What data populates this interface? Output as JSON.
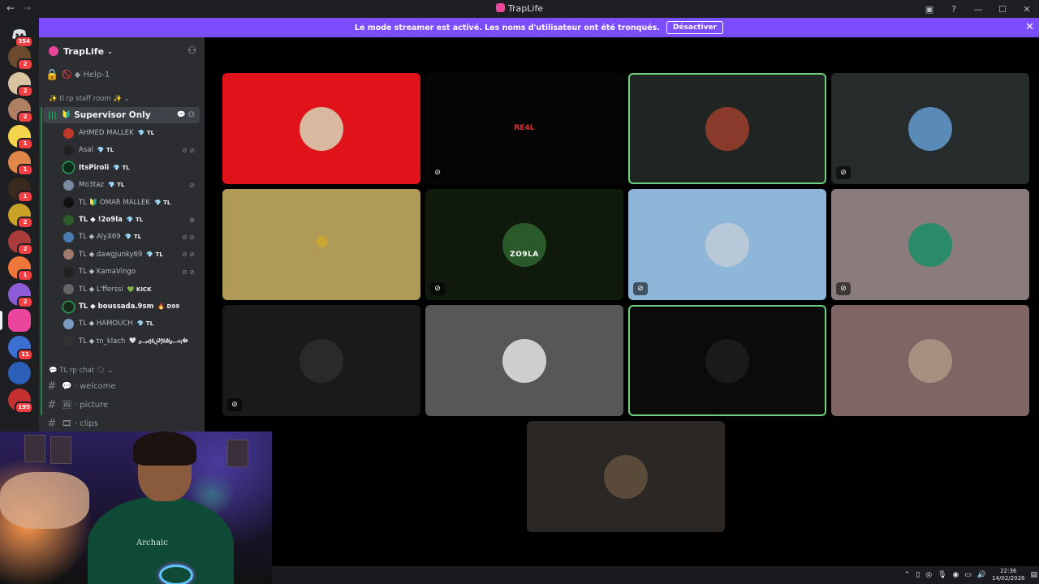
{
  "window": {
    "title": "TrapLife"
  },
  "banner": {
    "text": "Le mode streamer est activé. Les noms d'utilisateur ont été tronqués.",
    "button": "Désactiver"
  },
  "rail": {
    "home_badge": "354",
    "servers": [
      {
        "color": "#6b4a2e",
        "badge": "2"
      },
      {
        "color": "#d9c3a0",
        "badge": "2"
      },
      {
        "color": "#b07e62",
        "badge": "2"
      },
      {
        "color": "#f3d44a",
        "badge": "1"
      },
      {
        "color": "#e0884a",
        "badge": "1"
      },
      {
        "color": "#3a2a1e",
        "badge": "1"
      },
      {
        "color": "#c9a227",
        "badge": "2"
      },
      {
        "color": "#a93b3b",
        "badge": "2"
      },
      {
        "color": "#f0773a",
        "badge": "1"
      },
      {
        "color": "#8e5bd6",
        "badge": "2"
      },
      {
        "color": "#eb459e",
        "badge": ""
      },
      {
        "color": "#3b6fd1",
        "badge": "11"
      },
      {
        "color": "#2b5fb8",
        "badge": ""
      },
      {
        "color": "#c43030",
        "badge": "195"
      }
    ]
  },
  "sidebar": {
    "server_name": "TrapLife",
    "channels_top": [
      {
        "icon": "🔒",
        "label": "🚫 ◆ Help-1"
      }
    ],
    "category_staff": "✨ tl rp staff room ✨",
    "active_voice": "Supervisor Only",
    "voice_users": [
      {
        "name": "AHMED MALLEK",
        "tag": "💎 TL",
        "color": "#c0392b",
        "mute": "",
        "bold": false,
        "speaking": false
      },
      {
        "name": "Asal",
        "tag": "💎 TL",
        "color": "#222",
        "mute": "⊘ ⊘",
        "bold": false,
        "speaking": false
      },
      {
        "name": "ItsPiroli",
        "tag": "💎 TL",
        "color": "#0d2a1a",
        "mute": "",
        "bold": true,
        "speaking": true
      },
      {
        "name": "Mo3taz",
        "tag": "💎 TL",
        "color": "#7a8aa0",
        "mute": "⊘",
        "bold": false,
        "speaking": false
      },
      {
        "name": "TL 🔰 OMAR MALLEK",
        "tag": "💎 TL",
        "color": "#111",
        "mute": "",
        "bold": false,
        "speaking": false
      },
      {
        "name": "TL ◆ !2o9la",
        "tag": "💎 TL",
        "color": "#2f5a2a",
        "mute": "⊘",
        "bold": true,
        "speaking": false
      },
      {
        "name": "TL ◆ AlyX69",
        "tag": "💎 TL",
        "color": "#4a7ab0",
        "mute": "⊘ ⊘",
        "bold": false,
        "speaking": false
      },
      {
        "name": "TL ◆ dawgjunky69",
        "tag": "💎 TL",
        "color": "#a07a6a",
        "mute": "⊘ ⊘",
        "bold": false,
        "speaking": false
      },
      {
        "name": "TL ◆ KamaVingo",
        "tag": "",
        "color": "#222",
        "mute": "⊘ ⊘",
        "bold": false,
        "speaking": false
      },
      {
        "name": "TL ◆ L'fferssi",
        "tag": "💚 KICK",
        "color": "#666",
        "mute": "",
        "bold": false,
        "speaking": false
      },
      {
        "name": "TL ◆ boussada.9sm",
        "tag": "🔥 D99",
        "color": "#1a2a1a",
        "mute": "",
        "bold": true,
        "speaking": true
      },
      {
        "name": "TL ◆ HAMOUCH",
        "tag": "💎 TL",
        "color": "#7a9ac0",
        "mute": "",
        "bold": false,
        "speaking": false
      },
      {
        "name": "TL ◆ tn_klach",
        "tag": "🤍 ﷽ﷻ",
        "color": "#333",
        "mute": "",
        "bold": false,
        "speaking": false
      }
    ],
    "category_chat": "💬 TL rp chat 🗨",
    "text_channels": [
      {
        "label": "💬 · welcome"
      },
      {
        "label": "🖼 · picture"
      },
      {
        "label": "🎞 · clips"
      }
    ]
  },
  "tiles": [
    {
      "bg": "#e0131b",
      "avatar": "#d9b8a0",
      "mute": "",
      "speaking": false,
      "label": ""
    },
    {
      "bg": "#050505",
      "avatar": "",
      "mute": "⊘",
      "speaking": false,
      "label": "RE4L"
    },
    {
      "bg": "#1f2522",
      "avatar": "#8a3a2a",
      "mute": "",
      "speaking": true,
      "label": ""
    },
    {
      "bg": "#262b2c",
      "avatar": "#5a8ab8",
      "mute": "⊘",
      "speaking": false,
      "label": ""
    },
    {
      "bg": "#b09a57",
      "avatar": "",
      "mute": "",
      "speaking": false,
      "label": ""
    },
    {
      "bg": "#0f1a0c",
      "avatar": "#2a5a2a",
      "mute": "⊘",
      "speaking": false,
      "label": "ZO9LA"
    },
    {
      "bg": "#8eb6d9",
      "avatar": "#b8c8d8",
      "mute": "⊘",
      "speaking": false,
      "label": ""
    },
    {
      "bg": "#8a7c7c",
      "avatar": "#2a8a6a",
      "mute": "⊘",
      "speaking": false,
      "label": ""
    },
    {
      "bg": "#1a1a1a",
      "avatar": "#2a2a2a",
      "mute": "⊘",
      "speaking": false,
      "label": ""
    },
    {
      "bg": "#575757",
      "avatar": "#cfcfcf",
      "mute": "",
      "speaking": false,
      "label": ""
    },
    {
      "bg": "#0b0b0b",
      "avatar": "#1a1a1a",
      "mute": "",
      "speaking": true,
      "label": ""
    },
    {
      "bg": "#806565",
      "avatar": "#a89080",
      "mute": "",
      "speaking": false,
      "label": ""
    },
    {
      "bg": "#2a2724",
      "avatar": "#5a4a3a",
      "mute": "",
      "speaking": false,
      "label": ""
    }
  ],
  "webcam": {
    "shirt_text": "Archaic"
  },
  "taskbar": {
    "time": "22:36",
    "date": "14/02/2026"
  }
}
